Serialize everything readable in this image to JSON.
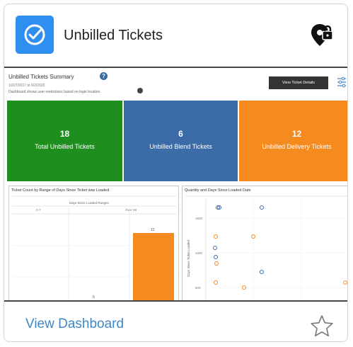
{
  "header": {
    "title": "Unbilled Tickets",
    "app_icon": "check-circle-icon",
    "status_icon": "location-lock-icon",
    "accent": "#2f8ff0"
  },
  "preview": {
    "title": "Unbilled Tickets Summary",
    "date_range": "10/27/2017 to 6/2/2020",
    "note": "Dashboard shows user restrictions based on login location.",
    "button": "View Ticket Details",
    "kpis": [
      {
        "value": "18",
        "label": "Total Unbilled Tickets",
        "color": "#1e8f1e"
      },
      {
        "value": "6",
        "label": "Unbilled Blend Tickets",
        "color": "#3c6ca8"
      },
      {
        "value": "12",
        "label": "Unbilled Delivery Tickets",
        "color": "#f58a1f"
      }
    ],
    "bar_pane": {
      "title": "Ticket Count by Range of Days Since Ticket was Loaded",
      "subheader": "Days Since Loaded Ranges",
      "col_labels": [
        "0-7",
        "Over 28"
      ],
      "bar_labels": [
        "6",
        "12"
      ]
    },
    "scatter_pane": {
      "title": "Quantity and Days Since Loaded Date",
      "y_ticks": [
        "1500",
        "1000",
        "500"
      ],
      "y_label": "Days Since Ticket Loaded"
    }
  },
  "footer": {
    "link": "View Dashboard",
    "favorite_icon": "star-icon"
  }
}
